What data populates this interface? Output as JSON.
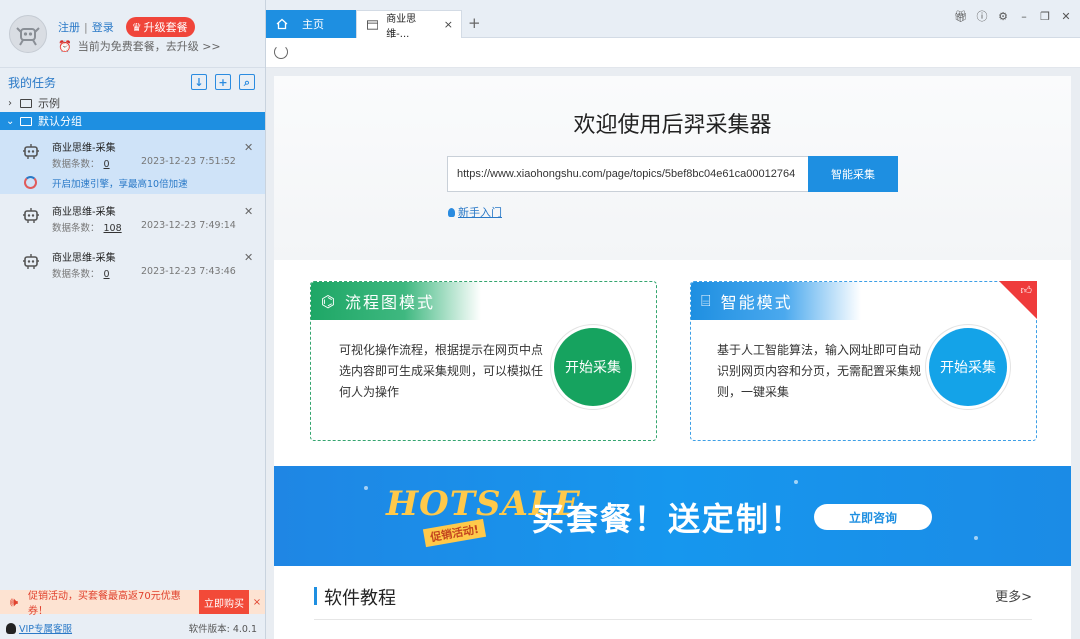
{
  "account": {
    "register": "注册",
    "separator": "|",
    "login": "登录",
    "upgrade": "升级套餐",
    "plan_notice": "当前为免费套餐，去升级 >>"
  },
  "tasks": {
    "header": "我的任务",
    "folders": [
      {
        "label": "示例",
        "expanded": false
      },
      {
        "label": "默认分组",
        "expanded": true
      }
    ],
    "count_label": "数据条数：",
    "items": [
      {
        "name": "商业思维-采集",
        "count": "0",
        "time": "2023-12-23 7:51:52",
        "boost": "开启加速引擎，享最高10倍加速"
      },
      {
        "name": "商业思维-采集",
        "count": "108",
        "time": "2023-12-23 7:49:14"
      },
      {
        "name": "商业思维-采集",
        "count": "0",
        "time": "2023-12-23 7:43:46"
      }
    ]
  },
  "promo": {
    "text": "促销活动，买套餐最高返70元优惠券！",
    "buy": "立即购买",
    "close": "×"
  },
  "footer": {
    "vip": "VIP专属客服",
    "version": "软件版本: 4.0.1"
  },
  "tabs": {
    "home": "主页",
    "page": "商业思维-...",
    "close": "×",
    "add": "+"
  },
  "welcome": {
    "title": "欢迎使用后羿采集器",
    "url": "https://www.xiaohongshu.com/page/topics/5bef8bc04e61ca00012764",
    "smart_button": "智能采集",
    "guide": "新手入门"
  },
  "modes": {
    "flow": {
      "title": "流程图模式",
      "desc": "可视化操作流程，根据提示在网页中点选内容即可生成采集规则，可以模拟任何人为操作",
      "button": "开始采集"
    },
    "smart": {
      "title": "智能模式",
      "desc": "基于人工智能算法，输入网址即可自动识别网页内容和分页，无需配置采集规则，一键采集",
      "button": "开始采集"
    }
  },
  "banner": {
    "hot": "HOTSALE",
    "tag": "促销活动!",
    "slogan": "买套餐！送定制！",
    "consult": "立即咨询"
  },
  "tutorial": {
    "title": "软件教程",
    "more": "更多>"
  },
  "colors": {
    "primary": "#1e8fe1",
    "flow_green": "#16a35f",
    "promo_red": "#f24a38"
  }
}
